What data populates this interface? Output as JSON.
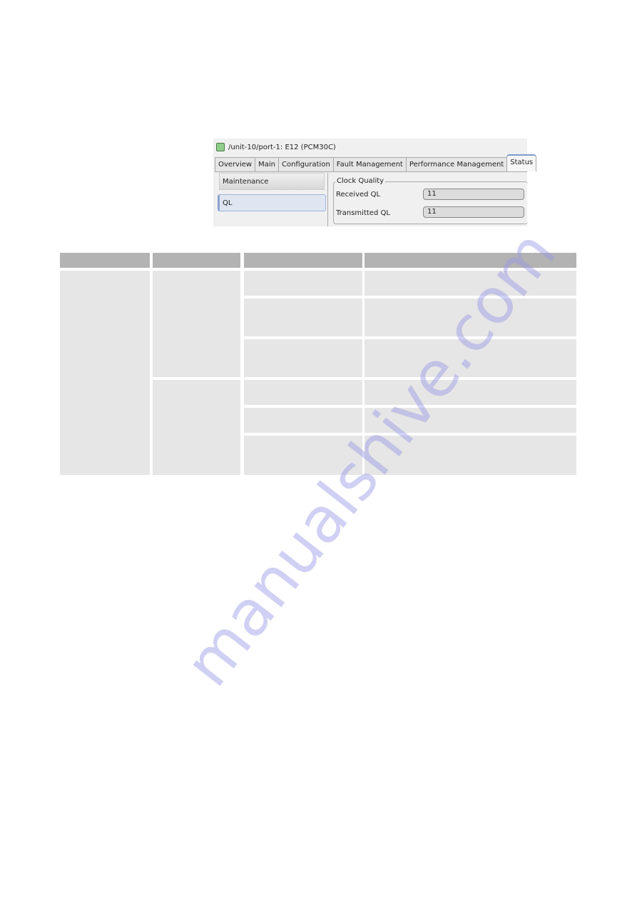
{
  "screenshot": {
    "title": "/unit-10/port-1: E12 (PCM30C)",
    "status_color": "#8fce8a",
    "tabs": [
      "Overview",
      "Main",
      "Configuration",
      "Fault Management",
      "Performance Management",
      "Status"
    ],
    "active_tab": "Status",
    "side_items": [
      "Maintenance",
      "QL"
    ],
    "group_label": "Clock Quality",
    "fields": [
      {
        "label": "Received QL",
        "value": "11"
      },
      {
        "label": "Transmitted QL",
        "value": "11"
      }
    ]
  },
  "table": {
    "header": [
      "",
      "",
      "",
      ""
    ],
    "rows": 6
  },
  "watermark": "manualshive.com"
}
